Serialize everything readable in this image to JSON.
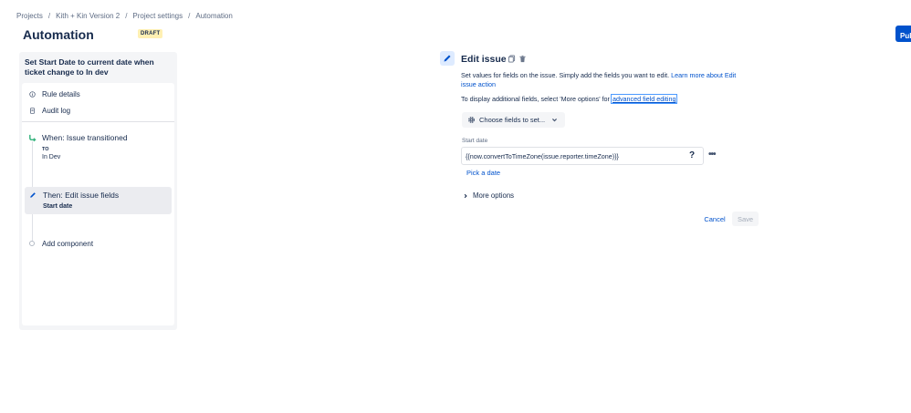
{
  "breadcrumb": {
    "items": [
      "Projects",
      "Kith + Kin Version 2",
      "Project settings",
      "Automation"
    ],
    "separator": "/"
  },
  "header": {
    "title": "Automation",
    "badge": "DRAFT",
    "publish_label": "Publish"
  },
  "rule": {
    "name": "Set Start Date to current date when ticket change to In dev",
    "menu": [
      {
        "label": "Rule details",
        "icon": "info-icon"
      },
      {
        "label": "Audit log",
        "icon": "document-icon"
      }
    ],
    "trigger": {
      "title": "When: Issue transitioned",
      "to_label": "TO",
      "to_value": "In Dev",
      "icon": "transition-icon"
    },
    "action": {
      "title": "Then: Edit issue fields",
      "subtitle": "Start date",
      "icon": "pencil-icon"
    },
    "add_component": "Add component"
  },
  "edit_panel": {
    "title": "Edit issue",
    "description": "Set values for fields on the issue. Simply add the fields you want to edit.",
    "learn_more": "Learn more about Edit issue action",
    "additional_text": "To display additional fields, select 'More options' for",
    "advanced_link": "advanced field editing",
    "choose_fields": "Choose fields to set...",
    "field_label": "Start date",
    "field_value": "{{now.convertToTimeZone(issue.reporter.timeZone)}}",
    "help": "?",
    "more": "•••",
    "pick_date": "Pick a date",
    "more_options": "More options",
    "cancel": "Cancel",
    "save": "Save"
  },
  "colors": {
    "primary": "#0052cc",
    "badge_bg": "#fff0b3",
    "trigger_icon": "#36b37e"
  }
}
